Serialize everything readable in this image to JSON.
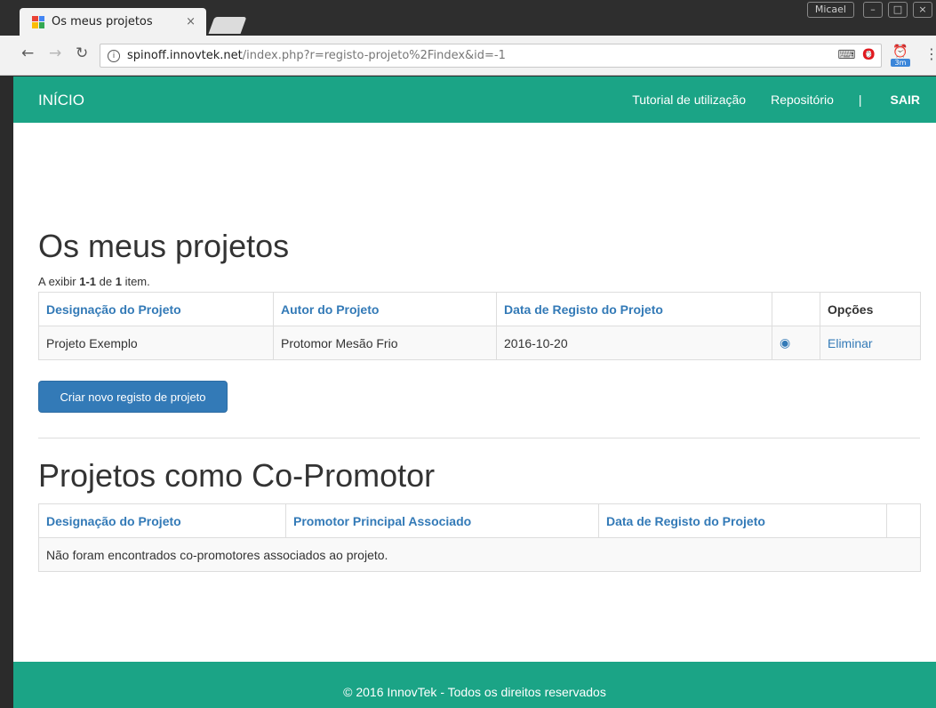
{
  "browser": {
    "tab_title": "Os meus projetos",
    "tab_close": "×",
    "user": "Micael",
    "url_host": "spinoff.innovtek.net",
    "url_path": "/index.php?r=registo-projeto%2Findex&id=-1",
    "extension_badge": "3m"
  },
  "navbar": {
    "brand": "INÍCIO",
    "links": {
      "tutorial": "Tutorial de utilização",
      "repositorio": "Repositório",
      "separator": "|",
      "sair": "SAIR"
    }
  },
  "my_projects": {
    "title": "Os meus projetos",
    "summary_prefix": "A exibir ",
    "summary_range": "1-1",
    "summary_mid": " de ",
    "summary_total": "1",
    "summary_suffix": " item.",
    "columns": [
      "Designação do Projeto",
      "Autor do Projeto",
      "Data de Registo do Projeto",
      "",
      "Opções"
    ],
    "rows": [
      {
        "designacao": "Projeto Exemplo",
        "autor": "Protomor Mesão Frio",
        "data": "2016-10-20",
        "delete": "Eliminar"
      }
    ],
    "create_button": "Criar novo registo de projeto"
  },
  "co_promoter": {
    "title": "Projetos como Co-Promotor",
    "columns": [
      "Designação do Projeto",
      "Promotor Principal Associado",
      "Data de Registo do Projeto",
      ""
    ],
    "empty_message": "Não foram encontrados co-promotores associados ao projeto."
  },
  "footer": {
    "text": "© 2016 InnovTek - Todos os direitos reservados"
  },
  "colors": {
    "brand_green": "#1ba486",
    "link_blue": "#337ab7"
  }
}
